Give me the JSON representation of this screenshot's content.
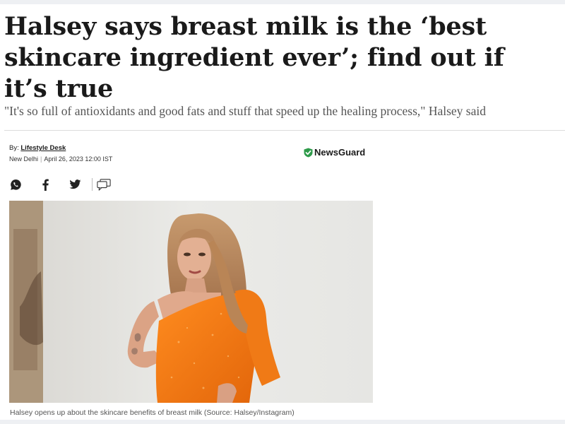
{
  "article": {
    "headline": "Halsey says breast milk is the ‘best skincare ingredient ever’; find out if it’s true",
    "subheadline": "\"It's so full of antioxidants and good fats and stuff that speed up the healing process,\" Halsey said",
    "byline_prefix": "By:",
    "author": "Lifestyle Desk",
    "location": "New Delhi",
    "date": "April 26, 2023 12:00 IST",
    "newsguard_label": "NewsGuard",
    "image_caption": "Halsey opens up about the skincare benefits of breast milk (Source: Halsey/Instagram)"
  },
  "share": {
    "icons": [
      "whatsapp-icon",
      "facebook-icon",
      "twitter-icon",
      "comment-icon"
    ]
  },
  "colors": {
    "headline": "#1a1a1a",
    "subheadline": "#555555",
    "newsguard_shield": "#2e9b4a",
    "dress_orange": "#f47a14"
  }
}
